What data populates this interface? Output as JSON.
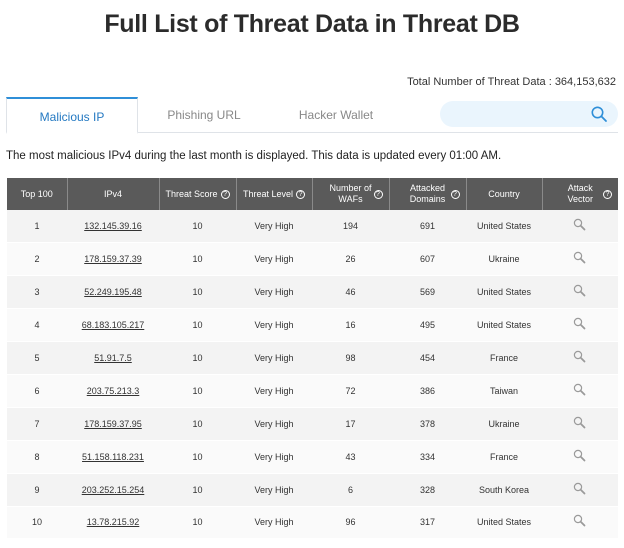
{
  "page": {
    "title": "Full List of Threat Data in Threat DB",
    "total_label": "Total Number of Threat Data : 364,153,632"
  },
  "tabs": [
    {
      "label": "Malicious IP",
      "active": true
    },
    {
      "label": "Phishing URL",
      "active": false
    },
    {
      "label": "Hacker Wallet",
      "active": false
    }
  ],
  "search": {
    "placeholder": "",
    "value": ""
  },
  "description": "The most malicious IPv4 during the last month is displayed. This data is updated every 01:00 AM.",
  "table": {
    "headers": {
      "top": "Top 100",
      "ipv4": "IPv4",
      "score": "Threat Score",
      "level": "Threat Level",
      "wafs_1": "Number of",
      "wafs_2": "WAFs",
      "domains_1": "Attacked",
      "domains_2": "Domains",
      "country": "Country",
      "vector_1": "Attack",
      "vector_2": "Vector",
      "help_glyph": "?"
    },
    "rows": [
      {
        "rank": "1",
        "ip": "132.145.39.16",
        "score": "10",
        "level": "Very High",
        "wafs": "194",
        "domains": "691",
        "country": "United States"
      },
      {
        "rank": "2",
        "ip": "178.159.37.39",
        "score": "10",
        "level": "Very High",
        "wafs": "26",
        "domains": "607",
        "country": "Ukraine"
      },
      {
        "rank": "3",
        "ip": "52.249.195.48",
        "score": "10",
        "level": "Very High",
        "wafs": "46",
        "domains": "569",
        "country": "United States"
      },
      {
        "rank": "4",
        "ip": "68.183.105.217",
        "score": "10",
        "level": "Very High",
        "wafs": "16",
        "domains": "495",
        "country": "United States"
      },
      {
        "rank": "5",
        "ip": "51.91.7.5",
        "score": "10",
        "level": "Very High",
        "wafs": "98",
        "domains": "454",
        "country": "France"
      },
      {
        "rank": "6",
        "ip": "203.75.213.3",
        "score": "10",
        "level": "Very High",
        "wafs": "72",
        "domains": "386",
        "country": "Taiwan"
      },
      {
        "rank": "7",
        "ip": "178.159.37.95",
        "score": "10",
        "level": "Very High",
        "wafs": "17",
        "domains": "378",
        "country": "Ukraine"
      },
      {
        "rank": "8",
        "ip": "51.158.118.231",
        "score": "10",
        "level": "Very High",
        "wafs": "43",
        "domains": "334",
        "country": "France"
      },
      {
        "rank": "9",
        "ip": "203.252.15.254",
        "score": "10",
        "level": "Very High",
        "wafs": "6",
        "domains": "328",
        "country": "South Korea"
      },
      {
        "rank": "10",
        "ip": "13.78.215.92",
        "score": "10",
        "level": "Very High",
        "wafs": "96",
        "domains": "317",
        "country": "United States"
      }
    ]
  },
  "colors": {
    "accent": "#2f8fd8",
    "header_bg": "#5a5a5a",
    "very_high": "#e8232a",
    "search_bg": "#eaf5fd"
  },
  "icons": {
    "search": "search-icon",
    "attack_vector": "magnifier-icon",
    "help": "help-circle-icon"
  }
}
